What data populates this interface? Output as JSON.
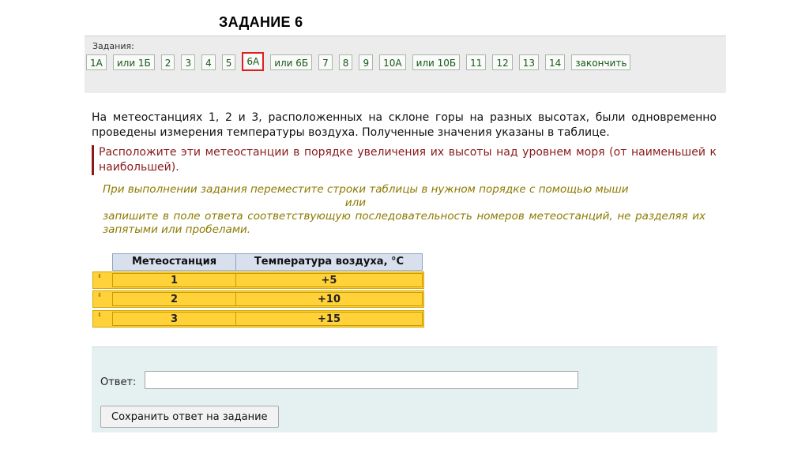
{
  "slide": {
    "title": "ЗАДАНИЕ 6"
  },
  "tasks": {
    "label": "Задания:",
    "buttons": [
      "1А",
      "или 1Б",
      "2",
      "3",
      "4",
      "5",
      "6А",
      "или 6Б",
      "7",
      "8",
      "9",
      "10А",
      "или 10Б",
      "11",
      "12",
      "13",
      "14",
      "закончить"
    ],
    "active": "6А"
  },
  "question": {
    "intro": "На метеостанциях 1, 2 и 3, расположенных на склоне горы на разных высотах, были одновременно проведены измерения температуры воздуха. Полученные значения указаны в таблице.",
    "instruction": "Расположите эти метеостанции в порядке увеличения их высоты над уровнем моря (от наименьшей к наибольшей).",
    "hint_line1": "При выполнении задания переместите строки таблицы в нужном порядке с помощью мыши",
    "hint_or": "или",
    "hint_line2": "запишите в поле ответа соответствующую последовательность номеров метеостанций, не разделяя их",
    "hint_line3": "запятыми или пробелами."
  },
  "table": {
    "headers": [
      "Метеостанция",
      "Температура воздуха, °С"
    ],
    "rows": [
      {
        "station": "1",
        "temp": "+5"
      },
      {
        "station": "2",
        "temp": "+10"
      },
      {
        "station": "3",
        "temp": "+15"
      }
    ]
  },
  "answer": {
    "label": "Ответ:",
    "value": "",
    "placeholder": "",
    "save_label": "Сохранить ответ на задание"
  },
  "colors": {
    "active_border": "#e02020",
    "instruction": "#8a1a1a",
    "hint": "#8c7a00",
    "row_fill": "#ffd23a"
  }
}
